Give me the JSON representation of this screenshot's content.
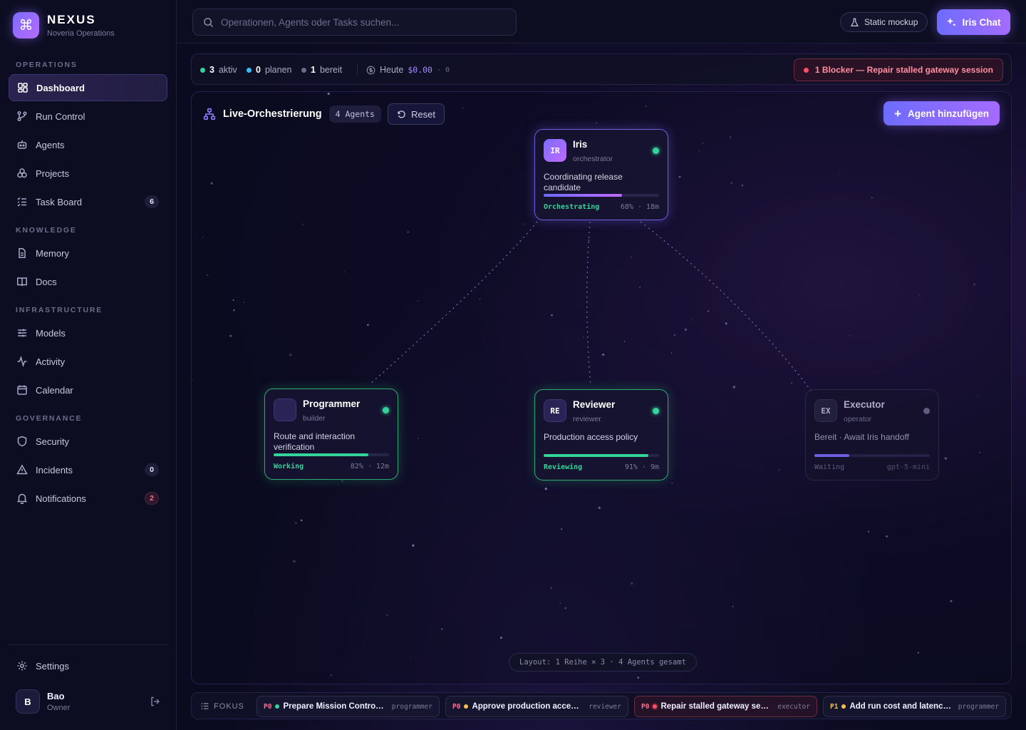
{
  "brand": {
    "name": "NEXUS",
    "subtitle": "Noveria Operations"
  },
  "sidebar": {
    "sections": [
      {
        "title": "OPERATIONS"
      },
      {
        "title": "KNOWLEDGE"
      },
      {
        "title": "INFRASTRUCTURE"
      },
      {
        "title": "GOVERNANCE"
      }
    ],
    "items": [
      {
        "label": "Dashboard",
        "icon": "dashboard-icon",
        "active": true
      },
      {
        "label": "Run Control",
        "icon": "branch-icon"
      },
      {
        "label": "Agents",
        "icon": "bot-icon"
      },
      {
        "label": "Projects",
        "icon": "projects-icon"
      },
      {
        "label": "Task Board",
        "icon": "task-list-icon",
        "badge": "6"
      },
      {
        "label": "Memory",
        "icon": "document-icon"
      },
      {
        "label": "Docs",
        "icon": "book-icon"
      },
      {
        "label": "Models",
        "icon": "sliders-icon"
      },
      {
        "label": "Activity",
        "icon": "activity-icon"
      },
      {
        "label": "Calendar",
        "icon": "calendar-icon"
      },
      {
        "label": "Security",
        "icon": "shield-icon"
      },
      {
        "label": "Incidents",
        "icon": "warning-icon",
        "badge": "0"
      },
      {
        "label": "Notifications",
        "icon": "bell-icon",
        "badge": "2"
      }
    ],
    "settings_label": "Settings",
    "user": {
      "initial": "B",
      "name": "Bao",
      "role": "Owner"
    }
  },
  "topbar": {
    "search_placeholder": "Operationen, Agents oder Tasks suchen...",
    "mockup_label": "Static mockup",
    "chat_label": "Iris Chat"
  },
  "status": {
    "active_count": "3",
    "active_label": "aktiv",
    "planning_count": "0",
    "planning_label": "planen",
    "ready_count": "1",
    "ready_label": "bereit",
    "today_label": "Heute",
    "today_cost": "$0.00",
    "today_extra": "· 0",
    "blocker": "1 Blocker — Repair stalled gateway session"
  },
  "orchestration": {
    "title": "Live-Orchestrierung",
    "agent_count": "4 Agents",
    "reset_label": "Reset",
    "add_label": "Agent hinzufügen",
    "layout_info": "Layout: 1 Reihe × 3 · 4 Agents gesamt"
  },
  "agents": [
    {
      "initials": "IR",
      "name": "Iris",
      "role": "orchestrator",
      "task": "Coordinating release candidate",
      "status": "Orchestrating",
      "meta": "68% · 18m",
      "progress": 0.68
    },
    {
      "initials": "",
      "name": "Programmer",
      "role": "builder",
      "task": "Route and interaction verification",
      "status": "Working",
      "meta": "82% · 12m",
      "progress": 0.82
    },
    {
      "initials": "RE",
      "name": "Reviewer",
      "role": "reviewer",
      "task": "Production access policy",
      "status": "Reviewing",
      "meta": "91% · 9m",
      "progress": 0.91
    },
    {
      "initials": "EX",
      "name": "Executor",
      "role": "operator",
      "task": "Bereit · Await Iris handoff",
      "status": "Waiting",
      "meta": "gpt-5-mini",
      "progress": 0.3
    }
  ],
  "focus": {
    "label": "FOKUS",
    "items": [
      {
        "priority": "P0",
        "title": "Prepare Mission Control r...",
        "role": "programmer",
        "dot": "#34d399"
      },
      {
        "priority": "P0",
        "title": "Approve production access ...",
        "role": "reviewer",
        "dot": "#f5c04a"
      },
      {
        "priority": "P0",
        "title": "Repair stalled gateway sessi...",
        "role": "executor",
        "dot": "#ff4d6a"
      },
      {
        "priority": "P1",
        "title": "Add run cost and latency b...",
        "role": "programmer",
        "dot": "#f5c04a"
      }
    ]
  },
  "colors": {
    "accent": "#7b6cff",
    "success": "#34d399",
    "danger": "#ff4d6a",
    "info": "#38bdf8"
  }
}
